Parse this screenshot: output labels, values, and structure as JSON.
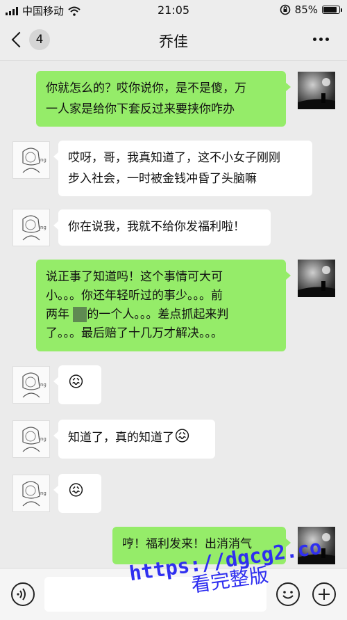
{
  "status_bar": {
    "carrier": "中国移动",
    "time": "21:05",
    "battery": "85%",
    "battery_level": 0.85
  },
  "nav": {
    "back_label": "4",
    "title": "乔佳",
    "more_icon": "more-dots-icon"
  },
  "messages": [
    {
      "side": "right",
      "lines": [
        "你就怎么的？哎你说你，是不是傻，万",
        "一人家是给你下套反过来要挟你咋办"
      ]
    },
    {
      "side": "left",
      "lines": [
        "哎呀，哥，我真知道了，这不小女子刚刚",
        "步入社会，一时被金钱冲昏了头脑嘛"
      ]
    },
    {
      "side": "left",
      "lines": [
        "你在说我，我就不给你发福利啦！"
      ]
    },
    {
      "side": "right",
      "lines": [
        "说正事了知道吗！这个事情可大可",
        "小。。。你还年轻听过的事少。。。前",
        "两年",
        "的一个人。。。差点抓起来判",
        "了。。。最后赔了十几万才解决。。。"
      ]
    },
    {
      "side": "left",
      "emoji": "😖"
    },
    {
      "side": "left",
      "text": "知道了，真的知道了",
      "emoji": "😖"
    },
    {
      "side": "left",
      "emoji": "😖"
    },
    {
      "side": "right",
      "lines": [
        "哼！福利发来！出",
        "消消气"
      ]
    }
  ],
  "input_bar": {
    "voice_icon": "voice-icon",
    "emoji_icon": "emoji-face-icon",
    "plus_icon": "plus-icon"
  },
  "watermark": {
    "url": "https://dgcg2.co",
    "text": "看完整版"
  }
}
